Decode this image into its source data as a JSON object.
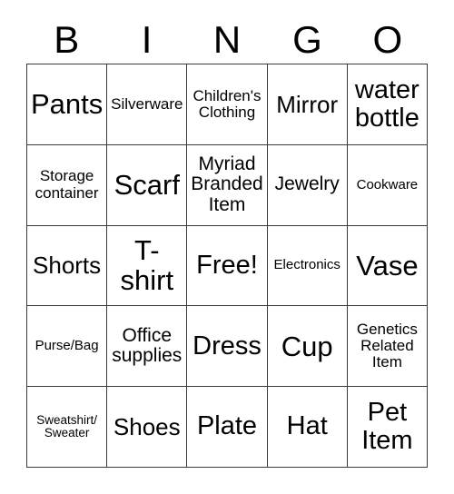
{
  "card": {
    "header_letters": [
      "B",
      "I",
      "N",
      "G",
      "O"
    ],
    "rows": [
      [
        {
          "label": "Pants",
          "size": "fs-xxl"
        },
        {
          "label": "Silverware",
          "size": "fs-s"
        },
        {
          "label": "Children's Clothing",
          "size": "fs-s"
        },
        {
          "label": "Mirror",
          "size": "fs-l"
        },
        {
          "label": "water bottle",
          "size": "fs-xl"
        }
      ],
      [
        {
          "label": "Storage container",
          "size": "fs-s"
        },
        {
          "label": "Scarf",
          "size": "fs-xxl"
        },
        {
          "label": "Myriad Branded Item",
          "size": "fs-m"
        },
        {
          "label": "Jewelry",
          "size": "fs-m"
        },
        {
          "label": "Cookware",
          "size": "fs-xs"
        }
      ],
      [
        {
          "label": "Shorts",
          "size": "fs-l"
        },
        {
          "label": "T-shirt",
          "size": "fs-xxl"
        },
        {
          "label": "Free!",
          "size": "fs-xl"
        },
        {
          "label": "Electronics",
          "size": "fs-xs"
        },
        {
          "label": "Vase",
          "size": "fs-xxl"
        }
      ],
      [
        {
          "label": "Purse/Bag",
          "size": "fs-xs"
        },
        {
          "label": "Office supplies",
          "size": "fs-m"
        },
        {
          "label": "Dress",
          "size": "fs-xl"
        },
        {
          "label": "Cup",
          "size": "fs-xxl"
        },
        {
          "label": "Genetics Related Item",
          "size": "fs-s"
        }
      ],
      [
        {
          "label": "Sweatshirt/ Sweater",
          "size": "fs-xxs"
        },
        {
          "label": "Shoes",
          "size": "fs-l"
        },
        {
          "label": "Plate",
          "size": "fs-xl"
        },
        {
          "label": "Hat",
          "size": "fs-xl"
        },
        {
          "label": "Pet Item",
          "size": "fs-xl"
        }
      ]
    ],
    "colors": {
      "border": "#3a3a3a",
      "text": "#000000",
      "background": "#ffffff"
    }
  }
}
